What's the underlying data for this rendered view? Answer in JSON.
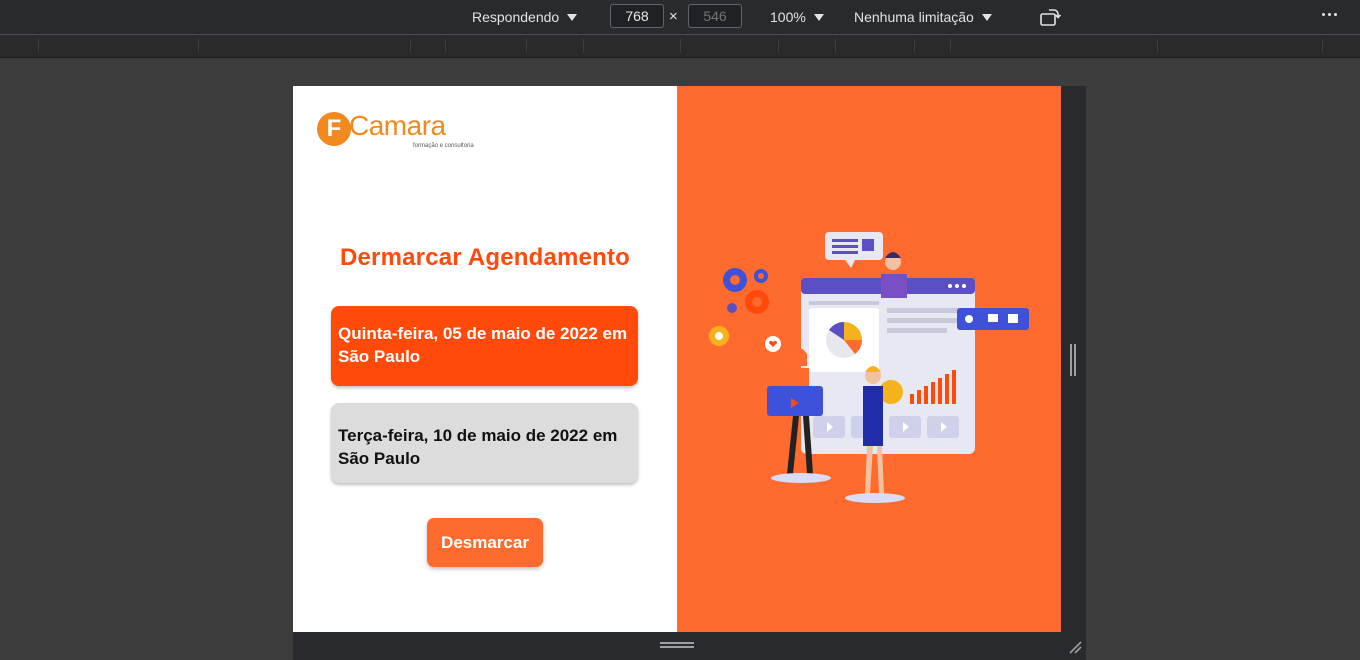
{
  "devtools": {
    "device_label": "Respondendo",
    "width_value": "768",
    "height_placeholder": "546",
    "times": "×",
    "zoom_label": "100%",
    "throttle_label": "Nenhuma limitação"
  },
  "page": {
    "logo": {
      "letter": "F",
      "name": "Camara",
      "tagline": "formação e consultoria"
    },
    "title": "Dermarcar Agendamento",
    "options": [
      {
        "label": "Quinta-feira, 05 de maio de 2022 em São Paulo",
        "selected": true
      },
      {
        "label": "Terça-feira, 10 de maio de 2022 em São Paulo",
        "selected": false
      }
    ],
    "button_label": "Desmarcar",
    "colors": {
      "accent": "#ff4a0a",
      "panel": "#ff6a2e",
      "logo": "#f08a1e"
    }
  }
}
